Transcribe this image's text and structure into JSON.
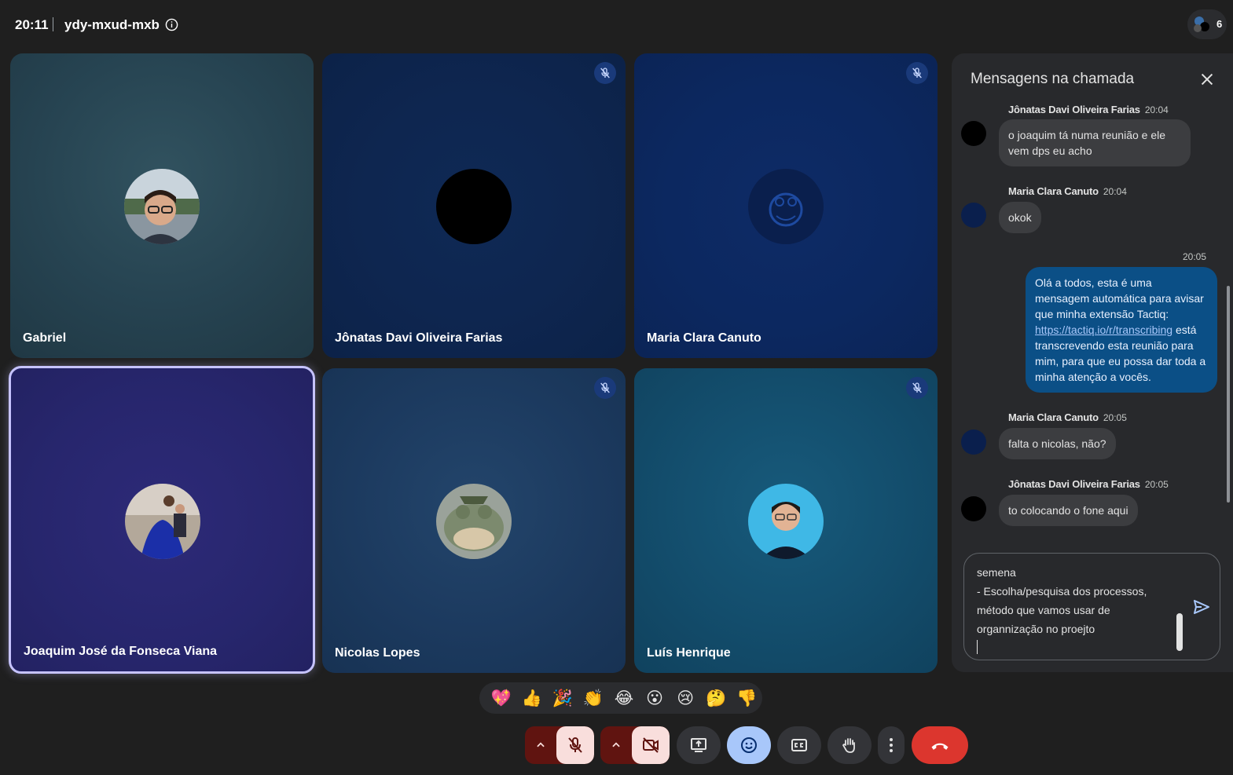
{
  "topbar": {
    "time": "20:11",
    "meeting_code": "ydy-mxud-mxb",
    "info_icon": "info-icon"
  },
  "people": {
    "count": "6"
  },
  "tiles": [
    {
      "name": "Gabriel",
      "muted": false
    },
    {
      "name": "Jônatas Davi Oliveira Farias",
      "muted": true
    },
    {
      "name": "Maria Clara Canuto",
      "muted": true
    },
    {
      "name": "Joaquim José da Fonseca Viana",
      "muted": false,
      "speaking": true
    },
    {
      "name": "Nicolas Lopes",
      "muted": true
    },
    {
      "name": "Luís Henrique",
      "muted": true
    }
  ],
  "chat": {
    "title": "Mensagens na chamada",
    "messages": [
      {
        "sender": "Jônatas Davi Oliveira Farias",
        "time": "20:04",
        "lines": [
          "o joaquim tá numa reunião e ele",
          "vem dps eu acho"
        ]
      },
      {
        "sender": "Maria Clara Canuto",
        "time": "20:04",
        "lines": [
          "okok"
        ]
      },
      {
        "sender": "me",
        "time": "20:05",
        "lines": [
          "Olá a todos, esta é uma",
          "mensagem automática para avisar",
          "que minha extensão Tactiq:"
        ],
        "link": "https://tactiq.io/r/transcribing",
        "link_suffix": " está",
        "lines_after": [
          "transcrevendo esta reunião para",
          "mim, para que eu possa dar toda a",
          "minha atenção a vocês."
        ]
      },
      {
        "sender": "Maria Clara Canuto",
        "time": "20:05",
        "lines": [
          "falta o nicolas, não?"
        ]
      },
      {
        "sender": "Jônatas Davi Oliveira Farias",
        "time": "20:05",
        "lines": [
          "to colocando o fone aqui"
        ]
      }
    ],
    "compose_text": "semena\n- Escolha/pesquisa dos processos,\nmétodo que vamos usar de\norgannização no proejto"
  },
  "reactions": [
    "💖",
    "👍",
    "🎉",
    "👏",
    "😂",
    "😮",
    "😢",
    "🤔",
    "👎"
  ],
  "colors": {
    "background": "#1f1f1f",
    "panel": "#28292c",
    "end_call": "#dc362e",
    "active_reaction": "#a8c7fa",
    "mic_off_bg": "#601410"
  }
}
